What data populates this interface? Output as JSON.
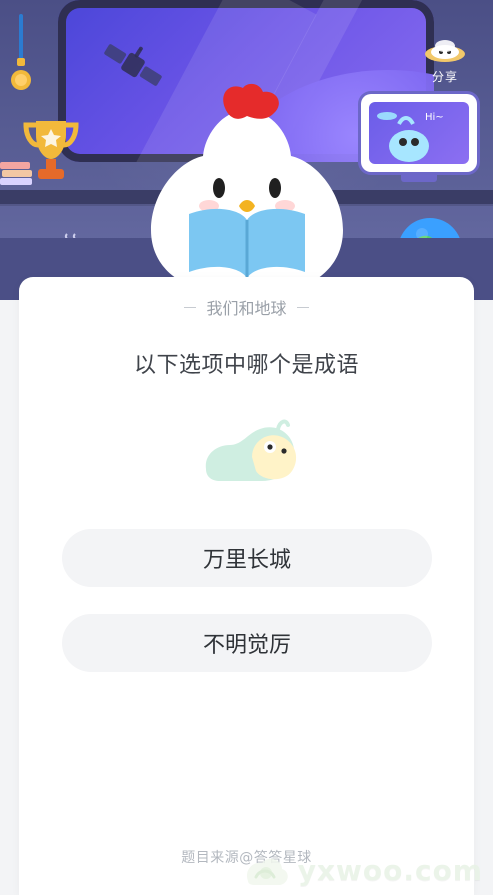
{
  "header": {
    "share_label": "分享",
    "tv_greeting": "Hi~"
  },
  "card": {
    "section_title": "我们和地球",
    "question": "以下选项中哪个是成语",
    "options": [
      {
        "label": "万里长城"
      },
      {
        "label": "不明觉厉"
      }
    ],
    "footer": "题目来源@答答星球"
  },
  "watermark": {
    "text": "yxwoo.com"
  },
  "icons": {
    "share": "ufo-icon",
    "illustration": "snail-icon"
  },
  "colors": {
    "page_bg": "#f3f4f6",
    "scene_bg": "#4b4f86",
    "card_bg": "#ffffff",
    "option_bg": "#f3f4f6",
    "primary_text": "#2f3338",
    "muted_text": "#9aa0a8"
  }
}
